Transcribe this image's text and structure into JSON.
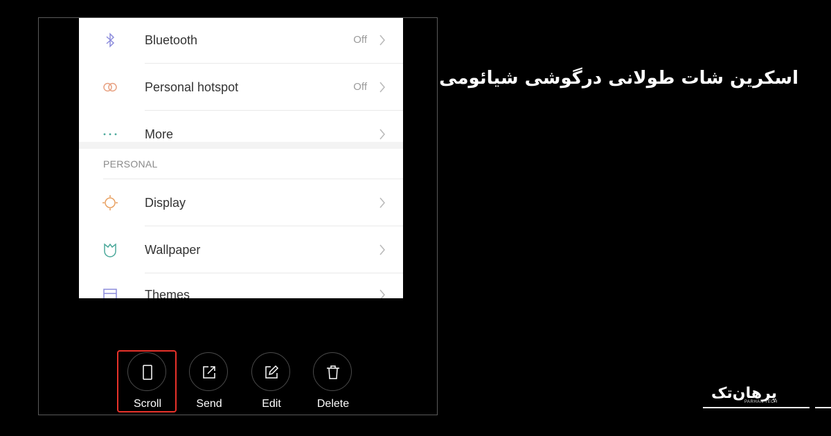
{
  "settings": {
    "rows_top": [
      {
        "label": "Bluetooth",
        "value": "Off",
        "icon": "bluetooth-icon"
      },
      {
        "label": "Personal hotspot",
        "value": "Off",
        "icon": "hotspot-icon"
      },
      {
        "label": "More",
        "value": "",
        "icon": "more-dots-icon"
      }
    ],
    "section_header": "PERSONAL",
    "rows_personal": [
      {
        "label": "Display",
        "icon": "display-sun-icon"
      },
      {
        "label": "Wallpaper",
        "icon": "wallpaper-tulip-icon"
      },
      {
        "label": "Themes",
        "icon": "themes-icon"
      }
    ]
  },
  "actions": [
    {
      "label": "Scroll",
      "icon": "scroll-phone-icon",
      "highlighted": true
    },
    {
      "label": "Send",
      "icon": "send-share-icon"
    },
    {
      "label": "Edit",
      "icon": "edit-pencil-icon"
    },
    {
      "label": "Delete",
      "icon": "delete-trash-icon"
    }
  ],
  "headline": "اسکرین شات طولانی درگوشی شیائومی",
  "logo": {
    "text": "پرهان‌تک",
    "subtitle": "PARHAN TECH"
  },
  "colors": {
    "highlight": "#e8322a",
    "background": "#000000",
    "screen": "#ffffff"
  }
}
